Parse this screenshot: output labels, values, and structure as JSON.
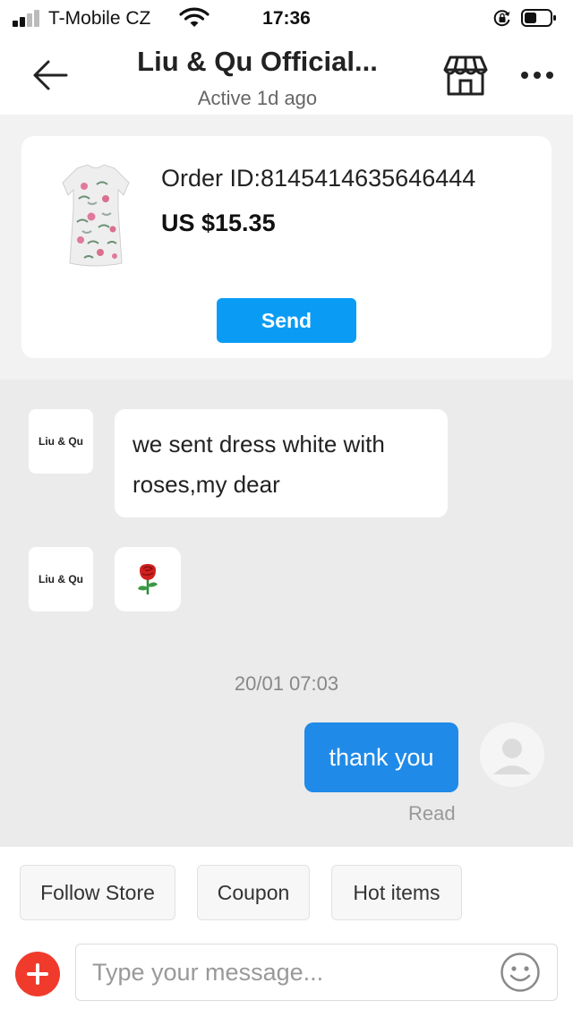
{
  "status_bar": {
    "carrier": "T-Mobile CZ",
    "time": "17:36",
    "signal_bars": 4,
    "signal_bars_active": 2,
    "icons": [
      "signal-icon",
      "wifi-icon",
      "rotation-lock-icon",
      "battery-icon"
    ]
  },
  "header": {
    "title": "Liu & Qu Official...",
    "subtitle": "Active 1d ago",
    "icons": [
      "back-arrow-icon",
      "store-icon",
      "more-options-icon"
    ]
  },
  "order_card": {
    "order_id": "Order ID:8145414635646444",
    "price": "US $15.35",
    "send_label": "Send",
    "product_image": "floral-dress-product-image"
  },
  "messages": [
    {
      "from": "store",
      "avatar_text": "Liu & Qu",
      "text": "we sent  dress white with roses,my dear"
    },
    {
      "from": "store",
      "avatar_text": "Liu & Qu",
      "emoji": "rose-icon"
    },
    {
      "timestamp": "20/01 07:03"
    },
    {
      "from": "user",
      "text": "thank you",
      "status": "Read",
      "avatar": "user-avatar-icon"
    }
  ],
  "quick_actions": [
    "Follow Store",
    "Coupon",
    "Hot items"
  ],
  "composer": {
    "placeholder": "Type your message...",
    "icons": [
      "add-icon",
      "emoji-icon"
    ]
  },
  "colors": {
    "send_button": "#0a9cf5",
    "outgoing_bubble": "#1f8ae8",
    "add_button": "#f03b2c",
    "chat_background": "#ebebeb"
  }
}
